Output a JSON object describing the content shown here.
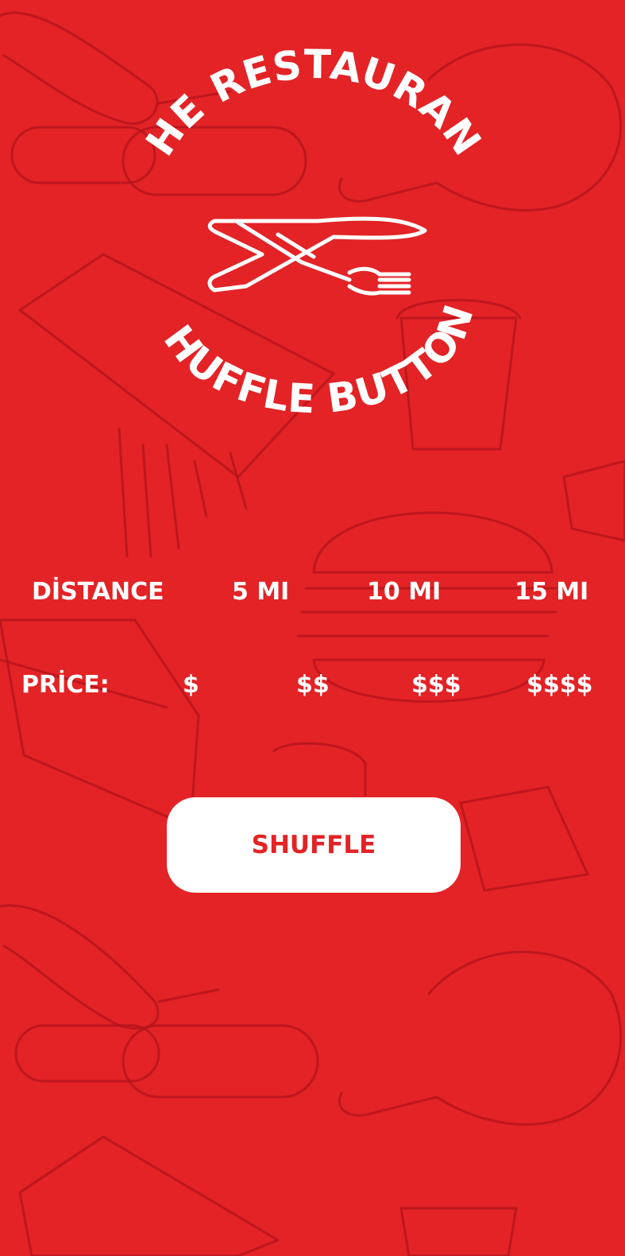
{
  "logo": {
    "top_text": "THE RESTAURANT",
    "bottom_text": "SHUFFLE BUTTON",
    "icon": "crossed-knife-fork-icon"
  },
  "distance": {
    "label": "DİSTANCE",
    "options": [
      "5 MI",
      "10 MI",
      "15 MI"
    ]
  },
  "price": {
    "label": "PRİCE:",
    "options": [
      "$",
      "$$",
      "$$$",
      "$$$$"
    ]
  },
  "shuffle_button": {
    "label": "SHUFFLE"
  },
  "colors": {
    "background": "#e32326",
    "doodle": "#b0141b",
    "button": "#ffffff",
    "accent": "#e32326"
  }
}
